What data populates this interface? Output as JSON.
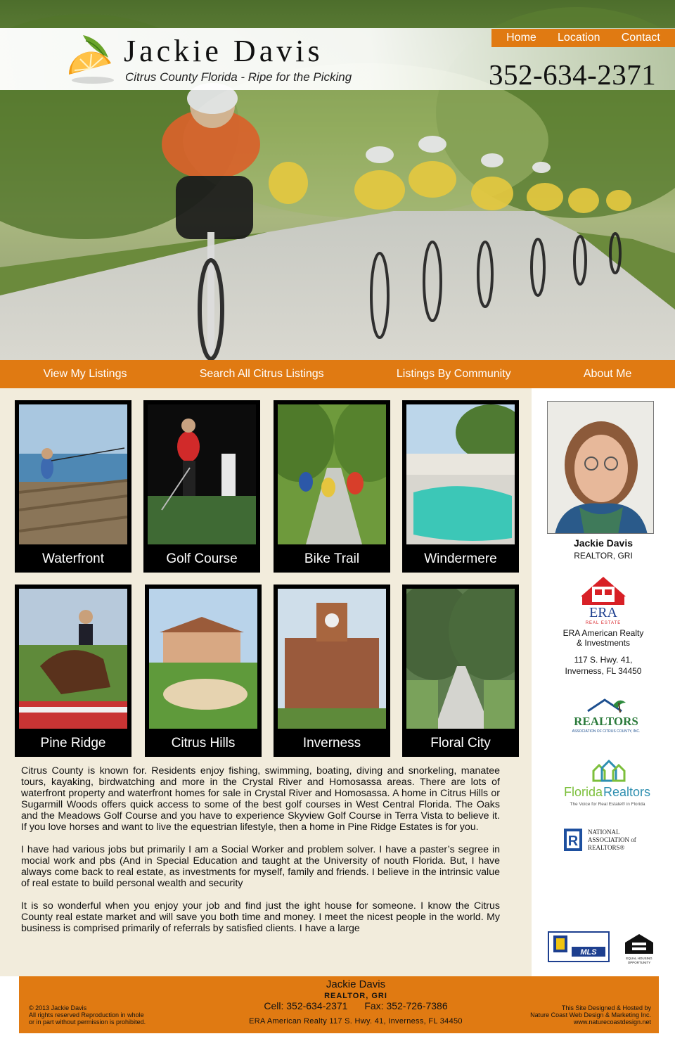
{
  "header": {
    "name": "Jackie Davis",
    "tagline": "Citrus County Florida - Ripe for the Picking",
    "phone": "352-634-2371",
    "nav": [
      "Home",
      "Location",
      "Contact"
    ]
  },
  "main_nav": [
    "View My Listings",
    "Search All Citrus Listings",
    "Listings By Community",
    "About Me"
  ],
  "communities": [
    {
      "label": "Waterfront"
    },
    {
      "label": "Golf Course"
    },
    {
      "label": "Bike Trail"
    },
    {
      "label": "Windermere"
    },
    {
      "label": "Pine Ridge"
    },
    {
      "label": "Citrus Hills"
    },
    {
      "label": "Inverness"
    },
    {
      "label": "Floral City"
    }
  ],
  "intro": [
    "Citrus County is known for. Residents enjoy fishing, swimming, boating, diving and snorkeling, manatee tours, kayaking, birdwatching and more in the Crystal River and Homosassa areas. There are lots of waterfront property and waterfront homes for sale in Crystal River and Homosassa. A home in Citrus Hills or Sugarmill Woods offers quick access to some of the best golf courses in West Central Florida. The Oaks and the Meadows Golf Course and you have to experience Skyview Golf Course in Terra Vista to believe it. If you love horses and want to live the equestrian lifestyle, then a home in Pine Ridge Estates is for you.",
    "I have had various jobs but primarily I am a Social Worker and problem solver. I have a paster’s segree in mocial work and pbs (And in Special Education and taught at the University of nouth Florida. But, I have always come back to real estate, as investments for myself, family and friends. I believe in the intrinsic value of real estate to build personal wealth and security",
    "It is so wonderful when you enjoy your job and find just the ight house for someone. I know the Citrus County real estate market and will save you both time and money. I meet the nicest people in the world.  My business is comprised primarily of referrals by satisfied clients. I have a large"
  ],
  "sidebar": {
    "agent_name": "Jackie Davis",
    "agent_title": "REALTOR, GRI",
    "brokerage": [
      "ERA American Realty",
      "& Investments"
    ],
    "address": [
      "117 S. Hwy. 41,",
      "Inverness, FL 34450"
    ],
    "logos": {
      "era": "ERA",
      "era_sub": "REAL ESTATE",
      "realtors_assoc": "REALTORS",
      "realtors_assoc_sub": "ASSOCIATION OF CITRUS COUNTY, INC.",
      "fl_realtors_a": "Florida",
      "fl_realtors_b": "Realtors",
      "fl_realtors_sub": "The Voice for Real Estate® in Florida",
      "nar": [
        "NATIONAL",
        "ASSOCIATION of",
        "REALTORS®"
      ],
      "mls": "MLS",
      "eho": [
        "EQUAL HOUSING",
        "OPPORTUNITY"
      ]
    }
  },
  "footer": {
    "name": "Jackie Davis",
    "title": "REALTOR, GRI",
    "cell": "Cell: 352-634-2371",
    "fax": "Fax: 352-726-7386",
    "address": "ERA American Realty 117 S. Hwy. 41, Inverness, FL 34450",
    "copyright": [
      "© 2013 Jackie Davis",
      "All rights reserved Reproduction in whole",
      "or in part without permission is prohibited."
    ],
    "credit": [
      "This Site Designed & Hosted by",
      "Nature Coast Web Design & Marketing Inc.",
      "www.naturecoastdesign.net"
    ]
  },
  "colors": {
    "accent_orange": "#e07a12",
    "content_bg": "#f2ecdc",
    "tile_bg": "#000000"
  }
}
